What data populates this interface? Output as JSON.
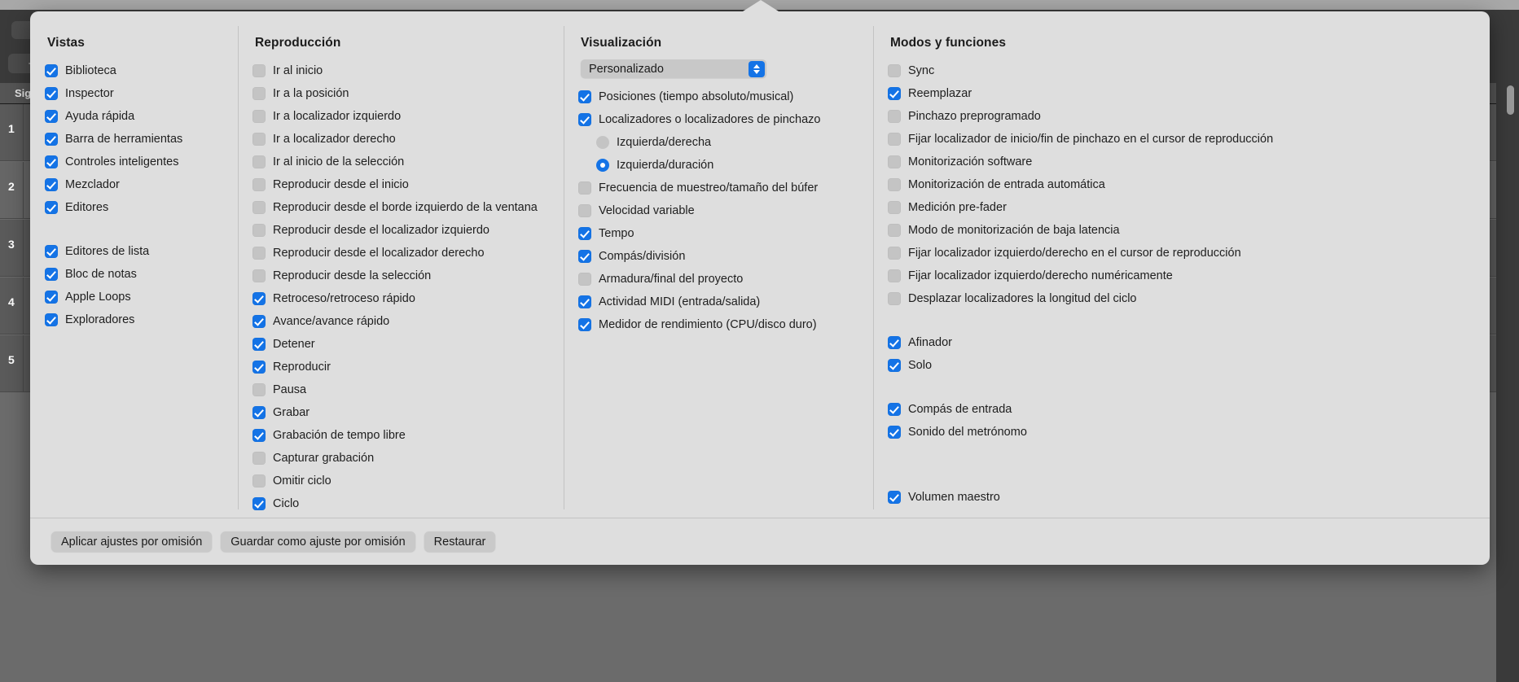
{
  "background": {
    "tracks_header": "Sig",
    "track_numbers": [
      "1",
      "2",
      "3",
      "4",
      "5"
    ],
    "nav_up_icon": "arrow-up-icon",
    "add_track_label": "+"
  },
  "popover": {
    "columns": {
      "views": {
        "title": "Vistas",
        "groups": [
          [
            {
              "label": "Biblioteca",
              "checked": true
            },
            {
              "label": "Inspector",
              "checked": true
            },
            {
              "label": "Ayuda rápida",
              "checked": true
            },
            {
              "label": "Barra de herramientas",
              "checked": true
            },
            {
              "label": "Controles inteligentes",
              "checked": true
            },
            {
              "label": "Mezclador",
              "checked": true
            },
            {
              "label": "Editores",
              "checked": true
            }
          ],
          [
            {
              "label": "Editores de lista",
              "checked": true
            },
            {
              "label": "Bloc de notas",
              "checked": true
            },
            {
              "label": "Apple Loops",
              "checked": true
            },
            {
              "label": "Exploradores",
              "checked": true
            }
          ]
        ]
      },
      "transport": {
        "title": "Reproducción",
        "items": [
          {
            "label": "Ir al inicio",
            "checked": false
          },
          {
            "label": "Ir a la posición",
            "checked": false
          },
          {
            "label": "Ir a localizador izquierdo",
            "checked": false
          },
          {
            "label": "Ir a localizador derecho",
            "checked": false
          },
          {
            "label": "Ir al inicio de la selección",
            "checked": false
          },
          {
            "label": "Reproducir desde el inicio",
            "checked": false
          },
          {
            "label": "Reproducir desde el borde izquierdo de la ventana",
            "checked": false
          },
          {
            "label": "Reproducir desde el localizador izquierdo",
            "checked": false
          },
          {
            "label": "Reproducir desde el localizador derecho",
            "checked": false
          },
          {
            "label": "Reproducir desde la selección",
            "checked": false
          },
          {
            "label": "Retroceso/retroceso rápido",
            "checked": true
          },
          {
            "label": "Avance/avance rápido",
            "checked": true
          },
          {
            "label": "Detener",
            "checked": true
          },
          {
            "label": "Reproducir",
            "checked": true
          },
          {
            "label": "Pausa",
            "checked": false
          },
          {
            "label": "Grabar",
            "checked": true
          },
          {
            "label": "Grabación de tempo libre",
            "checked": true
          },
          {
            "label": "Capturar grabación",
            "checked": false
          },
          {
            "label": "Omitir ciclo",
            "checked": false
          },
          {
            "label": "Ciclo",
            "checked": true
          }
        ]
      },
      "display": {
        "title": "Visualización",
        "preset": {
          "selected": "Personalizado",
          "options": [
            "Personalizado"
          ]
        },
        "items": [
          {
            "label": "Posiciones (tiempo absoluto/musical)",
            "checked": true,
            "type": "checkbox"
          },
          {
            "label": "Localizadores o localizadores de pinchazo",
            "checked": true,
            "type": "checkbox"
          },
          {
            "label": "Izquierda/derecha",
            "checked": false,
            "type": "radio",
            "indent": true
          },
          {
            "label": "Izquierda/duración",
            "checked": true,
            "type": "radio",
            "indent": true
          },
          {
            "label": "Frecuencia de muestreo/tamaño del búfer",
            "checked": false,
            "type": "checkbox"
          },
          {
            "label": "Velocidad variable",
            "checked": false,
            "type": "checkbox"
          },
          {
            "label": "Tempo",
            "checked": true,
            "type": "checkbox"
          },
          {
            "label": "Compás/división",
            "checked": true,
            "type": "checkbox"
          },
          {
            "label": "Armadura/final del proyecto",
            "checked": false,
            "type": "checkbox"
          },
          {
            "label": "Actividad MIDI (entrada/salida)",
            "checked": true,
            "type": "checkbox"
          },
          {
            "label": "Medidor de rendimiento (CPU/disco duro)",
            "checked": true,
            "type": "checkbox"
          }
        ]
      },
      "modes": {
        "title": "Modos y funciones",
        "groups": [
          [
            {
              "label": "Sync",
              "checked": false
            },
            {
              "label": "Reemplazar",
              "checked": true
            },
            {
              "label": "Pinchazo preprogramado",
              "checked": false
            },
            {
              "label": "Fijar localizador de inicio/fin de pinchazo en el cursor de reproducción",
              "checked": false
            },
            {
              "label": "Monitorización software",
              "checked": false
            },
            {
              "label": "Monitorización de entrada automática",
              "checked": false
            },
            {
              "label": "Medición pre-fader",
              "checked": false
            },
            {
              "label": "Modo de monitorización de baja latencia",
              "checked": false
            },
            {
              "label": "Fijar localizador izquierdo/derecho en el cursor de reproducción",
              "checked": false
            },
            {
              "label": "Fijar localizador izquierdo/derecho numéricamente",
              "checked": false
            },
            {
              "label": "Desplazar localizadores la longitud del ciclo",
              "checked": false
            }
          ],
          [
            {
              "label": "Afinador",
              "checked": true
            },
            {
              "label": "Solo",
              "checked": true
            }
          ],
          [
            {
              "label": "Compás de entrada",
              "checked": true
            },
            {
              "label": "Sonido del metrónomo",
              "checked": true
            }
          ],
          [
            {
              "label": "Volumen maestro",
              "checked": true
            }
          ]
        ]
      }
    },
    "footer": {
      "apply_defaults": "Aplicar ajustes por omisión",
      "save_as_default": "Guardar como ajuste por omisión",
      "restore": "Restaurar"
    }
  },
  "colors": {
    "accent": "#1473e6",
    "popover_bg": "#dedede",
    "unchecked": "#c4c4c4",
    "app_bg": "#6b6b6b"
  }
}
